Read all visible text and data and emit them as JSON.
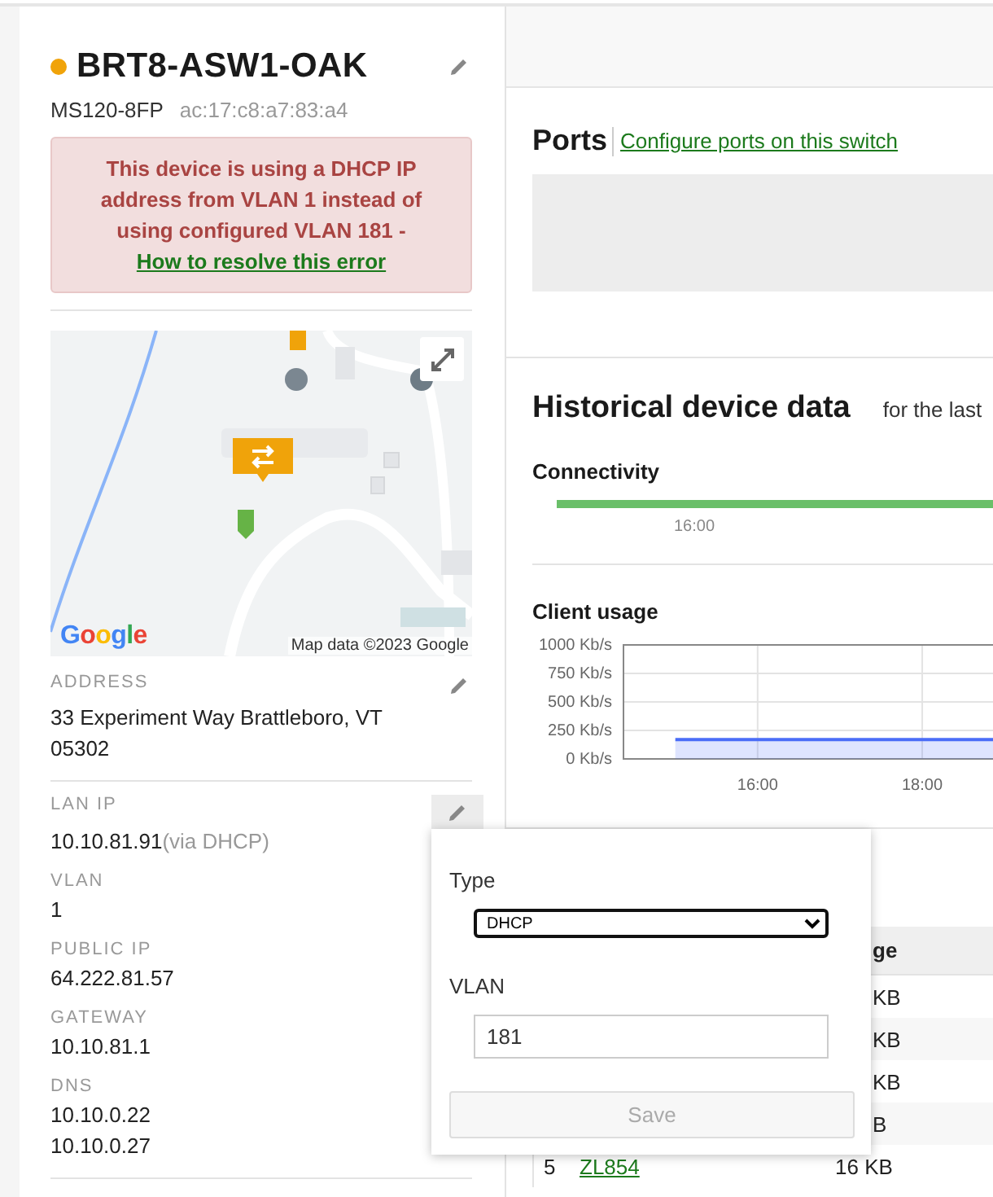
{
  "device": {
    "name": "BRT8-ASW1-OAK",
    "alerting": true,
    "model": "MS120-8FP",
    "mac": "ac:17:c8:a7:83:a4"
  },
  "alert": {
    "text": "This device is using a DHCP IP address from VLAN 1 instead of using configured VLAN 181 - ",
    "link": "How to resolve this error"
  },
  "map": {
    "kind": "picture",
    "attribution": "Map data ©2023 Google",
    "logo": "Google"
  },
  "address": {
    "label": "ADDRESS",
    "value": "33 Experiment Way Brattleboro, VT 05302"
  },
  "network": [
    {
      "label": "LAN IP",
      "values": [
        "10.10.81.91"
      ],
      "note": "(via DHCP)"
    },
    {
      "label": "VLAN",
      "values": [
        "1"
      ]
    },
    {
      "label": "PUBLIC IP",
      "values": [
        "64.222.81.57"
      ]
    },
    {
      "label": "GATEWAY",
      "values": [
        "10.10.81.1"
      ]
    },
    {
      "label": "DNS",
      "values": [
        "10.10.0.22",
        "10.10.0.27"
      ]
    }
  ],
  "ports": {
    "title": "Ports",
    "link": "Configure ports on this switch"
  },
  "history": {
    "title": "Historical device data",
    "subtitle": "for the last",
    "connectivity": {
      "title": "Connectivity",
      "tick": "16:00"
    },
    "client_usage": {
      "title": "Client usage",
      "chart_data": {
        "type": "area",
        "x": [
          15,
          18.86
        ],
        "grid": true,
        "series": [
          {
            "color": "#4a6cf7",
            "values": [
              170,
              170
            ]
          }
        ],
        "xlim": [
          14.37,
          18.86
        ],
        "ylim": [
          0,
          1000
        ],
        "xticks": [
          {
            "value": 16,
            "label": "16:00"
          },
          {
            "value": 18,
            "label": "18:00"
          }
        ],
        "yticks": [
          {
            "value": 0,
            "label": "0 Kb/s"
          },
          {
            "value": 250,
            "label": "250 Kb/s"
          },
          {
            "value": 500,
            "label": "500 Kb/s"
          },
          {
            "value": 750,
            "label": "750 Kb/s"
          },
          {
            "value": 1000,
            "label": "1000 Kb/s"
          }
        ]
      }
    }
  },
  "clients_table": {
    "header": "ge",
    "rows": [
      {
        "kind": "partial",
        "usage": "KB"
      },
      {
        "kind": "partial",
        "usage": "KB"
      },
      {
        "kind": "partial",
        "usage": "KB"
      },
      {
        "kind": "partial",
        "usage": "B"
      },
      {
        "kind": "full",
        "number": "5",
        "name": "ZL854",
        "usage": "16 KB"
      }
    ]
  },
  "ip_popup": {
    "type_label": "Type",
    "type_value": "DHCP",
    "vlan_label": "VLAN",
    "vlan_value": "181",
    "save": "Save",
    "save_disabled": true
  }
}
